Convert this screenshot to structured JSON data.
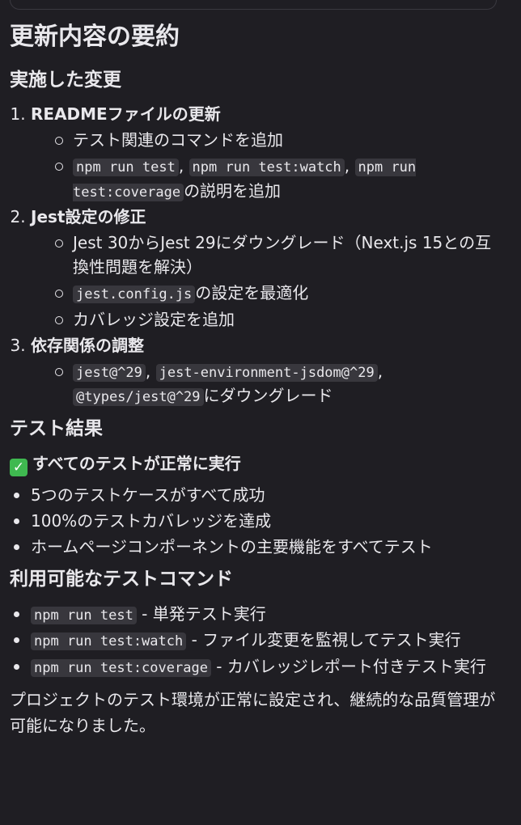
{
  "title": "更新内容の要約",
  "changes": {
    "heading": "実施した変更",
    "items": [
      {
        "title": "READMEファイルの更新",
        "sub": [
          {
            "text": "テスト関連のコマンドを追加"
          },
          {
            "codes": [
              "npm run test",
              "npm run test:watch",
              "npm run test:coverage"
            ],
            "sep": ", ",
            "suffix": "の説明を追加"
          }
        ]
      },
      {
        "title": "Jest設定の修正",
        "sub": [
          {
            "text": "Jest 30からJest 29にダウングレード（Next.js 15との互換性問題を解決）"
          },
          {
            "codes": [
              "jest.config.js"
            ],
            "suffix": "の設定を最適化"
          },
          {
            "text": "カバレッジ設定を追加"
          }
        ]
      },
      {
        "title": "依存関係の調整",
        "sub": [
          {
            "codes": [
              "jest@^29",
              "jest-environment-jsdom@^29",
              "@types/jest@^29"
            ],
            "sep": ", ",
            "suffix": "にダウングレード"
          }
        ]
      }
    ]
  },
  "results": {
    "heading": "テスト結果",
    "status": "すべてのテストが正常に実行",
    "items": [
      "5つのテストケースがすべて成功",
      "100%のテストカバレッジを達成",
      "ホームページコンポーネントの主要機能をすべてテスト"
    ]
  },
  "commands": {
    "heading": "利用可能なテストコマンド",
    "items": [
      {
        "code": "npm run test",
        "desc": " - 単発テスト実行"
      },
      {
        "code": "npm run test:watch",
        "desc": " - ファイル変更を監視してテスト実行"
      },
      {
        "code": "npm run test:coverage",
        "desc": " - カバレッジレポート付きテスト実行"
      }
    ]
  },
  "closing": "プロジェクトのテスト環境が正常に設定され、継続的な品質管理が可能になりました。"
}
